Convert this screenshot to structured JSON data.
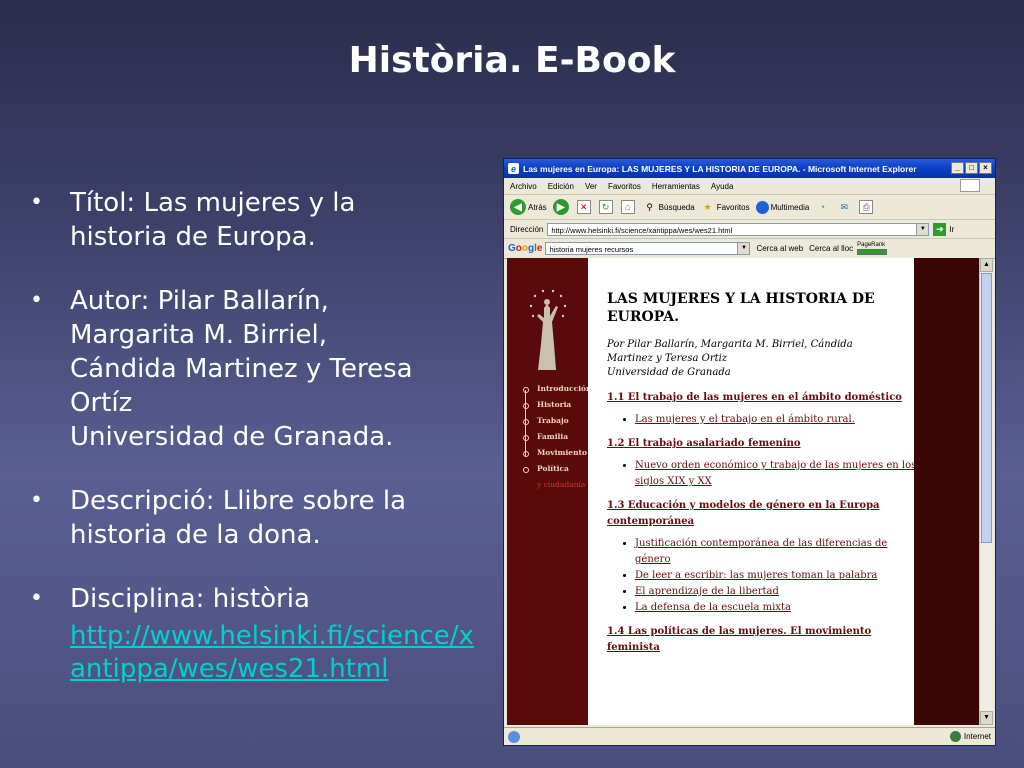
{
  "slide": {
    "title": "Història. E-Book",
    "bullets": [
      {
        "lines": [
          "Títol: Las mujeres y la",
          "historia de Europa."
        ]
      },
      {
        "lines": [
          "Autor: Pilar Ballarín,",
          "Margarita M. Birriel,",
          "Cándida Martinez y Teresa",
          "Ortíz",
          "Universidad de Granada."
        ]
      },
      {
        "lines": [
          "Descripció: Llibre sobre la",
          "historia de la dona."
        ]
      },
      {
        "lines": [
          "Disciplina: història"
        ]
      }
    ],
    "bullet_glyph": "•",
    "link": "http://www.helsinki.fi/science/xantippa/wes/wes21.html"
  },
  "browser": {
    "title": "Las mujeres en Europa: LAS MUJERES Y LA HISTORIA DE EUROPA. - Microsoft Internet Explorer",
    "menu": [
      "Archivo",
      "Edición",
      "Ver",
      "Favoritos",
      "Herramientas",
      "Ayuda"
    ],
    "toolbar": {
      "back": "Atrás",
      "search": "Búsqueda",
      "favorites": "Favoritos",
      "multimedia": "Multimedia"
    },
    "address_label": "Dirección",
    "address_value": "http://www.helsinki.fi/science/xantippa/wes/wes21.html",
    "go_label": "Ir",
    "google": {
      "logo": "Google",
      "query": "historia mujeres recursos",
      "search_web": "Cerca al web",
      "search_site": "Cerca al lloc",
      "pagerank": "PageRank"
    },
    "sidenav": [
      "Introducción",
      "Historia",
      "Trabajo",
      "Familia",
      "Movimiento",
      "Política"
    ],
    "sidenav_more": "y ciudadanía",
    "doc": {
      "heading": "LAS MUJERES Y LA HISTORIA DE EUROPA.",
      "byline": [
        "Por Pilar Ballarín, Margarita M. Birriel, Cándida",
        "Martinez y Teresa Ortiz",
        "Universidad de Granada"
      ],
      "sections": [
        {
          "title": "1.1 El trabajo de las mujeres en el ámbito doméstico",
          "items": [
            "Las mujeres y el trabajo en el ámbito rural."
          ]
        },
        {
          "title": "1.2 El trabajo asalariado femenino",
          "items": [
            "Nuevo orden económico y trabajo de las mujeres en los siglos XIX y XX"
          ]
        },
        {
          "title": "1.3 Educación y modelos de género en la Europa contemporánea",
          "items": [
            "Justificación contemporánea de las diferencias de género",
            "De leer a escribir: las mujeres toman la palabra",
            "El aprendizaje de la libertad",
            "La defensa de la escuela mixta"
          ]
        },
        {
          "title": "1.4 Las políticas de las mujeres. El movimiento feminista",
          "items": []
        }
      ]
    },
    "status_zone": "Internet"
  }
}
